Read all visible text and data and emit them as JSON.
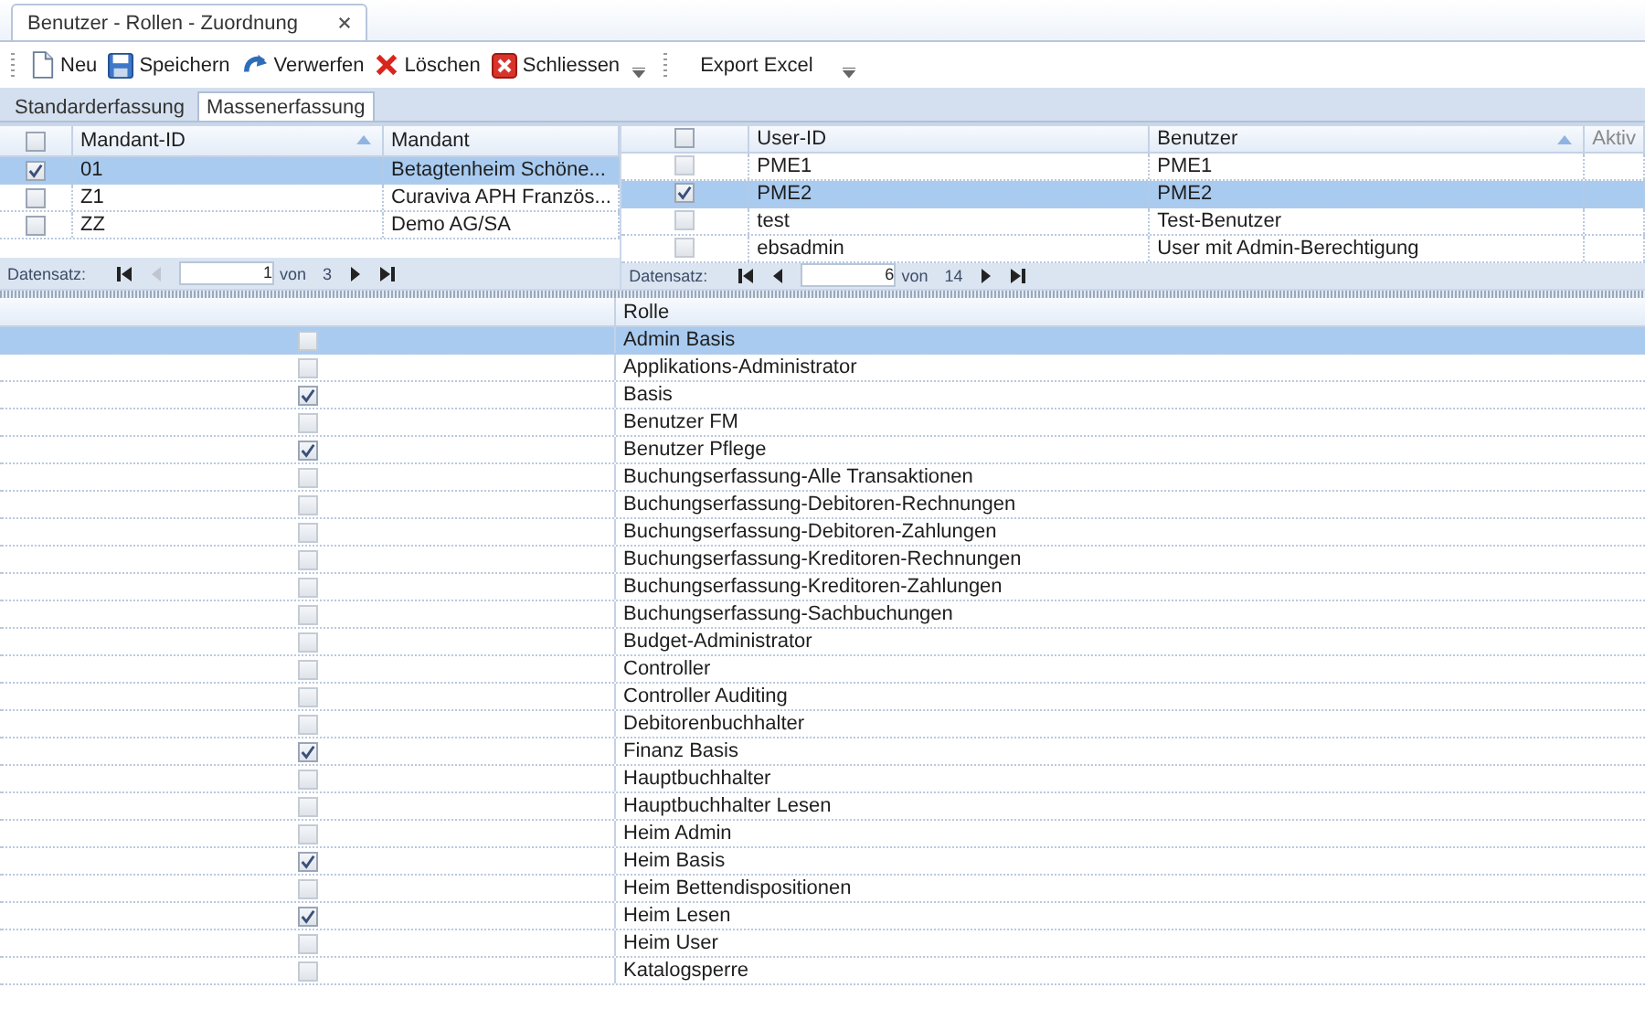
{
  "window": {
    "tab_title": "Benutzer - Rollen - Zuordnung"
  },
  "toolbar": [
    {
      "kind": "new",
      "label": "Neu"
    },
    {
      "kind": "save",
      "label": "Speichern"
    },
    {
      "kind": "undo",
      "label": "Verwerfen"
    },
    {
      "kind": "delete",
      "label": "Löschen"
    },
    {
      "kind": "close",
      "label": "Schliessen"
    },
    {
      "kind": "export",
      "label": "Export Excel"
    }
  ],
  "tabs": [
    {
      "label": "Standarderfassung",
      "selected": false
    },
    {
      "label": "Massenerfassung",
      "selected": true
    }
  ],
  "mandant_grid": {
    "header_checked": false,
    "columns": [
      {
        "label": "Mandant-ID",
        "sorted": true
      },
      {
        "label": "Mandant",
        "sorted": false
      }
    ],
    "rows": [
      {
        "checked": true,
        "selected": true,
        "cells": [
          "01",
          "Betagtenheim Schöne..."
        ]
      },
      {
        "checked": false,
        "selected": false,
        "cells": [
          "Z1",
          "Curaviva APH Französ..."
        ]
      },
      {
        "checked": false,
        "selected": false,
        "cells": [
          "ZZ",
          "Demo AG/SA"
        ]
      }
    ],
    "pager": {
      "label": "Datensatz:",
      "value": "1",
      "of": "von",
      "total": "3",
      "prev_disabled": true
    }
  },
  "user_grid": {
    "header_checked": false,
    "columns": [
      {
        "label": "User-ID",
        "sorted": false
      },
      {
        "label": "Benutzer",
        "sorted": true
      },
      {
        "label": "Aktiv",
        "sorted": false
      }
    ],
    "rows": [
      {
        "checked": false,
        "selected": false,
        "cells": [
          "PME1",
          "PME1"
        ]
      },
      {
        "checked": true,
        "selected": true,
        "cells": [
          "PME2",
          "PME2"
        ]
      },
      {
        "checked": false,
        "selected": false,
        "cells": [
          "test",
          "Test-Benutzer"
        ]
      },
      {
        "checked": false,
        "selected": false,
        "cells": [
          "ebsadmin",
          "User mit Admin-Berechtigung"
        ]
      }
    ],
    "pager": {
      "label": "Datensatz:",
      "value": "6",
      "of": "von",
      "total": "14",
      "prev_disabled": false
    }
  },
  "role_grid": {
    "column": "Rolle",
    "rows": [
      {
        "label": "Admin Basis",
        "checked": false,
        "selected": true
      },
      {
        "label": "Applikations-Administrator",
        "checked": false,
        "selected": false
      },
      {
        "label": "Basis",
        "checked": true,
        "selected": false
      },
      {
        "label": "Benutzer FM",
        "checked": false,
        "selected": false
      },
      {
        "label": "Benutzer Pflege",
        "checked": true,
        "selected": false
      },
      {
        "label": "Buchungserfassung-Alle Transaktionen",
        "checked": false,
        "selected": false
      },
      {
        "label": "Buchungserfassung-Debitoren-Rechnungen",
        "checked": false,
        "selected": false
      },
      {
        "label": "Buchungserfassung-Debitoren-Zahlungen",
        "checked": false,
        "selected": false
      },
      {
        "label": "Buchungserfassung-Kreditoren-Rechnungen",
        "checked": false,
        "selected": false
      },
      {
        "label": "Buchungserfassung-Kreditoren-Zahlungen",
        "checked": false,
        "selected": false
      },
      {
        "label": "Buchungserfassung-Sachbuchungen",
        "checked": false,
        "selected": false
      },
      {
        "label": "Budget-Administrator",
        "checked": false,
        "selected": false
      },
      {
        "label": "Controller",
        "checked": false,
        "selected": false
      },
      {
        "label": "Controller Auditing",
        "checked": false,
        "selected": false
      },
      {
        "label": "Debitorenbuchhalter",
        "checked": false,
        "selected": false
      },
      {
        "label": "Finanz Basis",
        "checked": true,
        "selected": false
      },
      {
        "label": "Hauptbuchhalter",
        "checked": false,
        "selected": false
      },
      {
        "label": "Hauptbuchhalter Lesen",
        "checked": false,
        "selected": false
      },
      {
        "label": "Heim Admin",
        "checked": false,
        "selected": false
      },
      {
        "label": "Heim Basis",
        "checked": true,
        "selected": false
      },
      {
        "label": "Heim Bettendispositionen",
        "checked": false,
        "selected": false
      },
      {
        "label": "Heim Lesen",
        "checked": true,
        "selected": false
      },
      {
        "label": "Heim User",
        "checked": false,
        "selected": false
      },
      {
        "label": "Katalogsperre",
        "checked": false,
        "selected": false
      }
    ]
  }
}
